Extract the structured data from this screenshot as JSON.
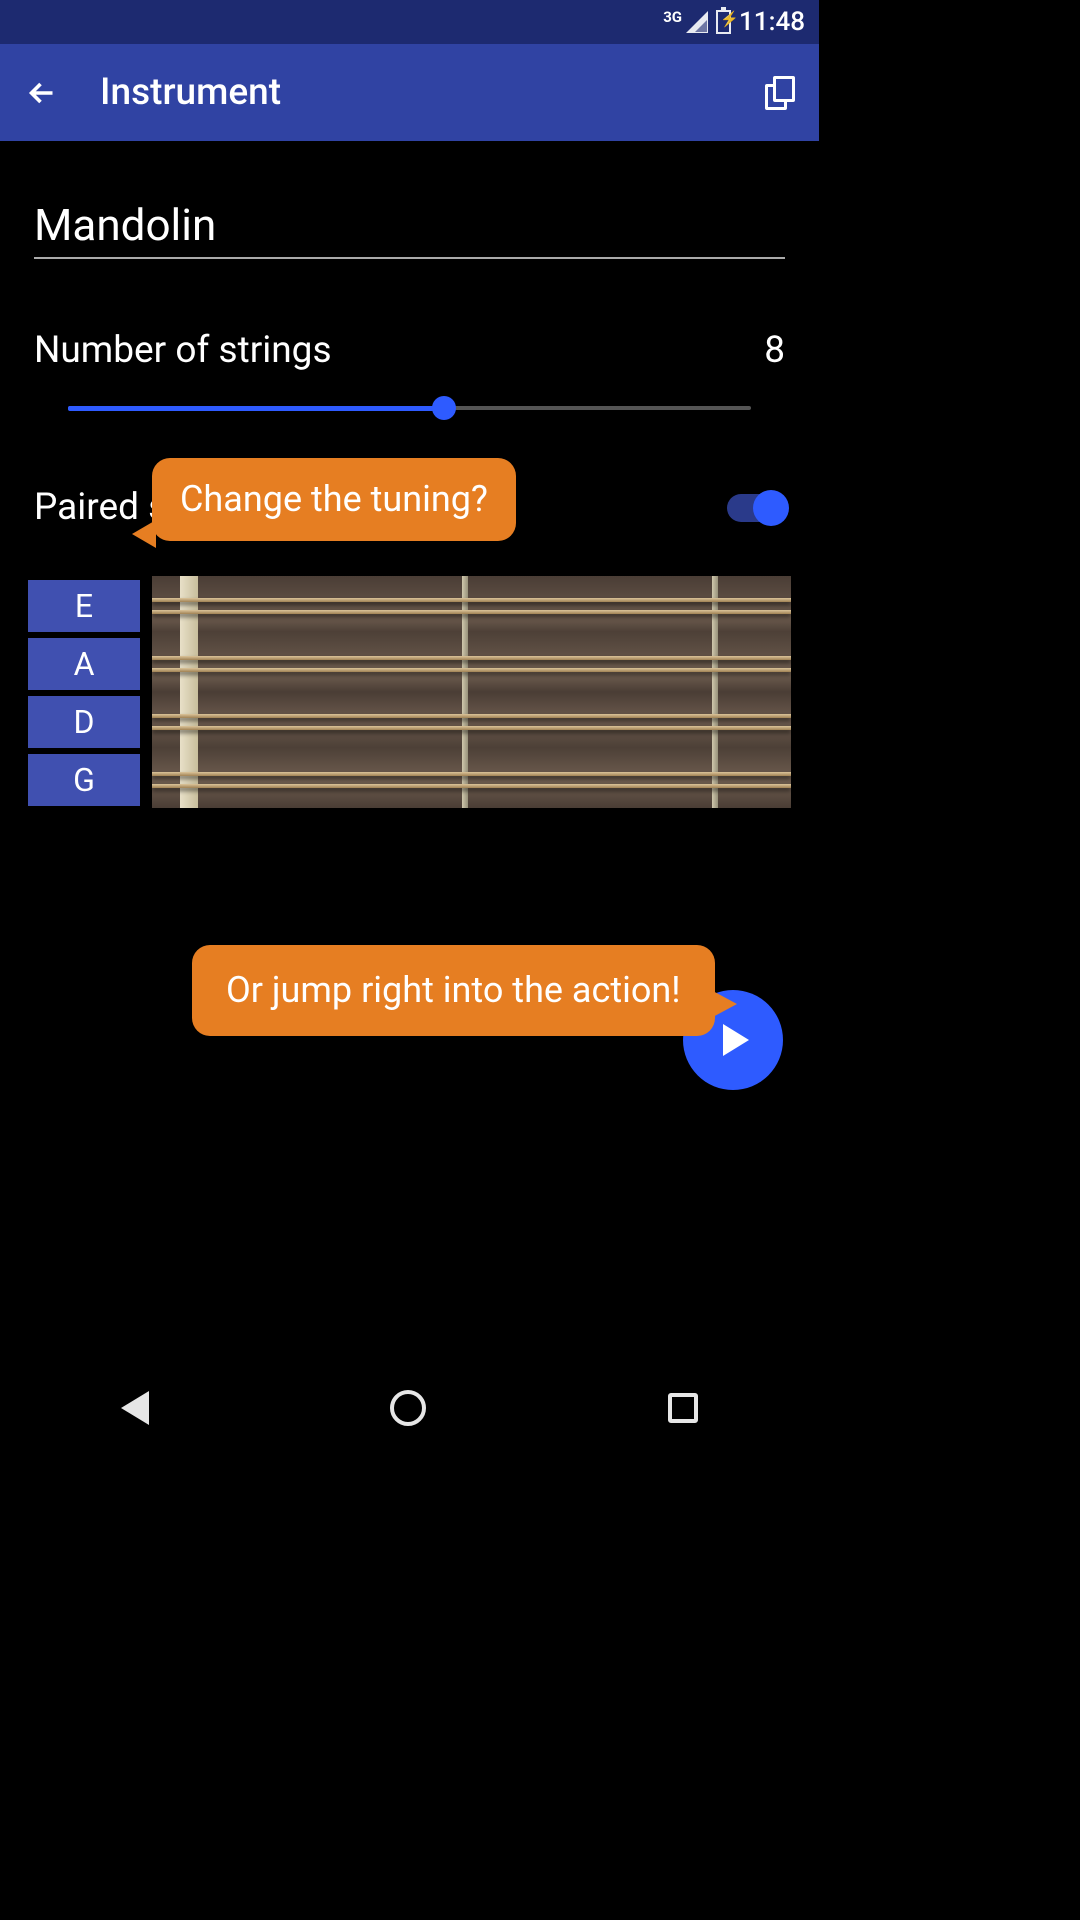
{
  "status": {
    "network": "3G",
    "time": "11:48"
  },
  "appbar": {
    "title": "Instrument"
  },
  "instrument": {
    "name": "Mandolin"
  },
  "strings": {
    "label": "Number of strings",
    "value": "8"
  },
  "paired": {
    "label": "Paired strings",
    "enabled": true
  },
  "notes": [
    "E",
    "A",
    "D",
    "G"
  ],
  "tooltips": {
    "tuning": "Change the tuning?",
    "action": "Or jump right into the action!"
  }
}
